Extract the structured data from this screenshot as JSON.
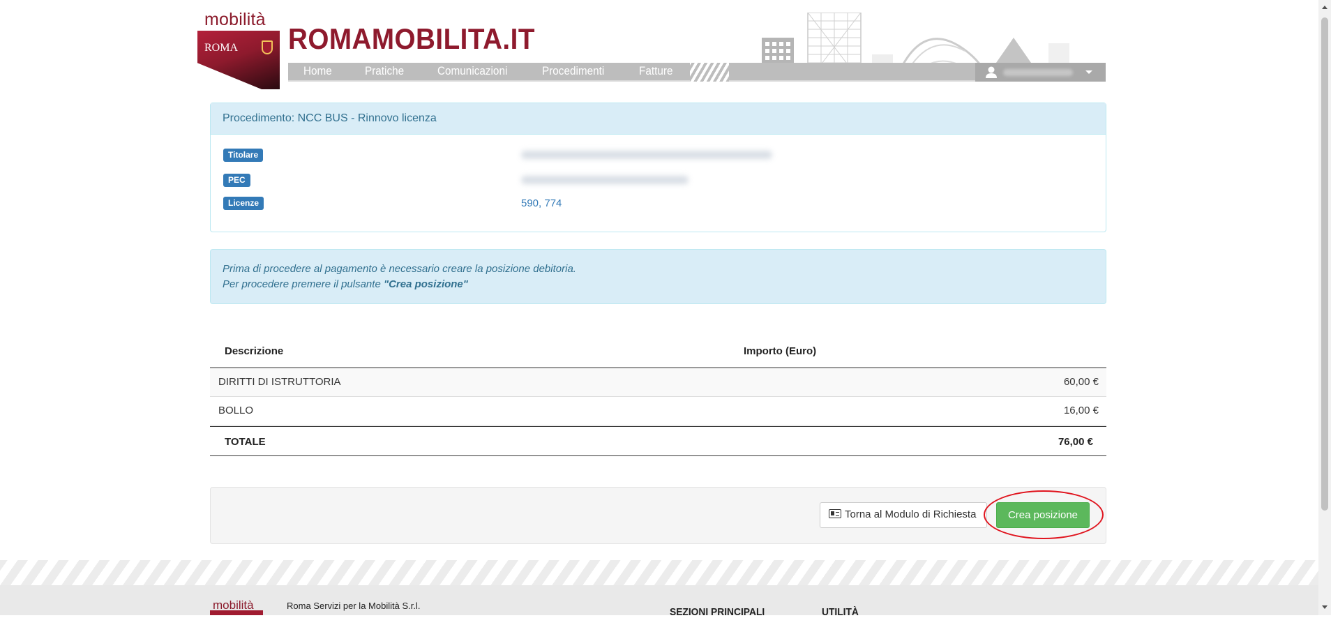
{
  "header": {
    "logo_word": "mobilità",
    "logo_city": "ROMA",
    "site_title": "ROMAMOBILITA.IT",
    "nav": [
      "Home",
      "Pratiche",
      "Comunicazioni",
      "Procedimenti",
      "Fatture"
    ],
    "user_menu_icon": "user-icon"
  },
  "panel": {
    "heading": "Procedimento: NCC BUS - Rinnovo licenza",
    "labels": {
      "titolare": "Titolare",
      "pec": "PEC",
      "licenze": "Licenze"
    },
    "licenze_value": "590, 774"
  },
  "alert": {
    "line1": "Prima di procedere al pagamento è necessario creare la posizione debitoria.",
    "line2_prefix": "Per procedere premere il pulsante ",
    "line2_emphasis": "\"Crea posizione\""
  },
  "table": {
    "headers": [
      "Descrizione",
      "Importo (Euro)"
    ],
    "rows": [
      {
        "descrizione": "DIRITTI DI ISTRUTTORIA",
        "importo": "60,00 €"
      },
      {
        "descrizione": "BOLLO",
        "importo": "16,00 €"
      }
    ],
    "total": {
      "label": "TOTALE",
      "value": "76,00 €"
    }
  },
  "actions": {
    "back_label": "Torna al Modulo di Richiesta",
    "back_icon": "id-card-icon",
    "create_label": "Crea posizione"
  },
  "footer": {
    "logo_word": "mobilità",
    "company": "Roma Servizi per la Mobilità S.r.l.",
    "sections_heading": "SEZIONI PRINCIPALI",
    "utility_heading": "UTILITÀ"
  },
  "colors": {
    "brand": "#8e1a2d",
    "nav_bg": "#bdbdbd",
    "info_bg": "#d9edf7",
    "info_text": "#31708f",
    "label_blue": "#337ab7",
    "success": "#5cb85c",
    "highlight": "#e0141e"
  }
}
